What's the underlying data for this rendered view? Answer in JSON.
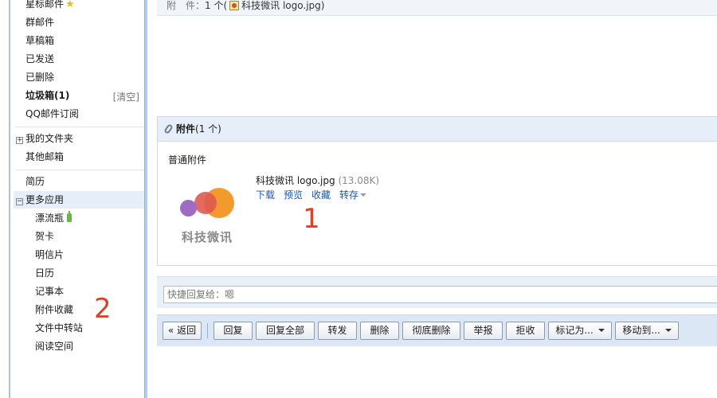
{
  "sidebar": {
    "items": [
      {
        "label": "星标邮件"
      },
      {
        "label": "群邮件"
      },
      {
        "label": "草稿箱"
      },
      {
        "label": "已发送"
      },
      {
        "label": "已删除"
      },
      {
        "label": "垃圾箱(1)",
        "action": "[清空]"
      },
      {
        "label": "QQ邮件订阅"
      },
      {
        "label": "我的文件夹"
      },
      {
        "label": "其他邮箱"
      },
      {
        "label": "简历"
      },
      {
        "label": "更多应用"
      }
    ],
    "apps": [
      {
        "label": "漂流瓶"
      },
      {
        "label": "贺卡"
      },
      {
        "label": "明信片"
      },
      {
        "label": "日历"
      },
      {
        "label": "记事本"
      },
      {
        "label": "附件收藏"
      },
      {
        "label": "文件中转站"
      },
      {
        "label": "阅读空间"
      }
    ]
  },
  "attachment_bar": {
    "label": "附　件：",
    "count": "1 个",
    "open_paren": "(",
    "file": "科技微讯 logo.jpg",
    "close_paren": ")"
  },
  "attachment_panel": {
    "title": "附件",
    "count": "(1 个)",
    "kind": "普通附件",
    "thumbnail_caption": "科技微讯",
    "file_name": "科技微讯 logo.jpg",
    "file_size": "(13.08K)",
    "actions": [
      "下载",
      "预览",
      "收藏",
      "转存"
    ],
    "logo_colors": [
      "#f29a2e",
      "#e05a4f",
      "#a06bc2"
    ]
  },
  "annotations": [
    "1",
    "2"
  ],
  "quick_reply": {
    "placeholder": "快捷回复给：嗯"
  },
  "toolbar": {
    "back": "« 返回",
    "reply": "回复",
    "reply_all": "回复全部",
    "forward": "转发",
    "delete": "删除",
    "delete_perm": "彻底删除",
    "report": "举报",
    "reject": "拒收",
    "mark_as": "标记为...",
    "move_to": "移动到..."
  },
  "colors": {
    "accent": "#1c57a8",
    "annotation": "#d9422b"
  }
}
